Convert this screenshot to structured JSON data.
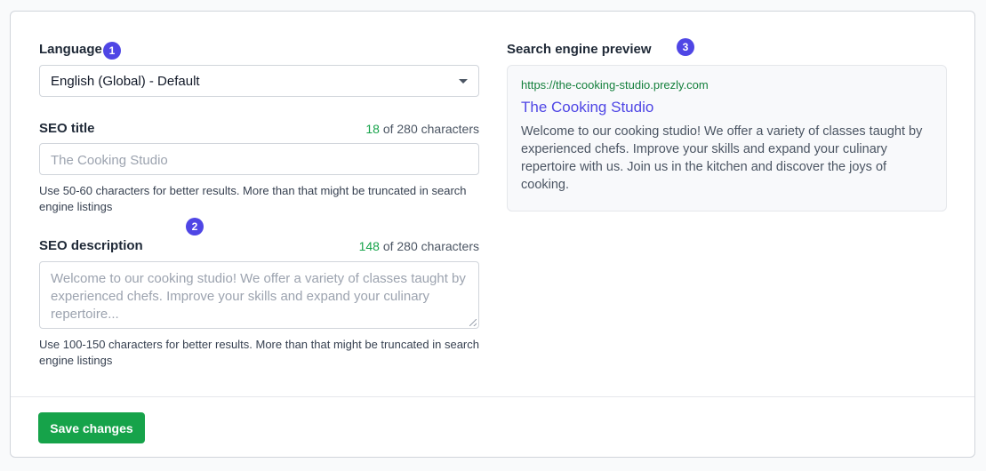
{
  "language": {
    "label": "Language",
    "step": "1",
    "selected": "English (Global) - Default"
  },
  "seo_title": {
    "label": "SEO title",
    "count": "18",
    "count_suffix": " of 280 characters",
    "placeholder": "The Cooking Studio",
    "helper": "Use 50-60 characters for better results. More than that might be truncated in search engine listings"
  },
  "step2": "2",
  "seo_description": {
    "label": "SEO description",
    "count": "148",
    "count_suffix": " of 280 characters",
    "placeholder": "Welcome to our cooking studio! We offer a variety of classes taught by experienced chefs. Improve your skills and expand your culinary repertoire...",
    "helper": "Use 100-150 characters for better results. More than that might be truncated in search engine listings"
  },
  "preview": {
    "label": "Search engine preview",
    "step": "3",
    "url": "https://the-cooking-studio.prezly.com",
    "title": "The Cooking Studio",
    "description": "Welcome to our cooking studio! We offer a variety of classes taught by experienced chefs. Improve your skills and expand your culinary repertoire with us. Join us in the kitchen and discover the joys of cooking."
  },
  "footer": {
    "save_label": "Save changes"
  },
  "colors": {
    "accent": "#4f46e5",
    "success": "#16a34a"
  }
}
